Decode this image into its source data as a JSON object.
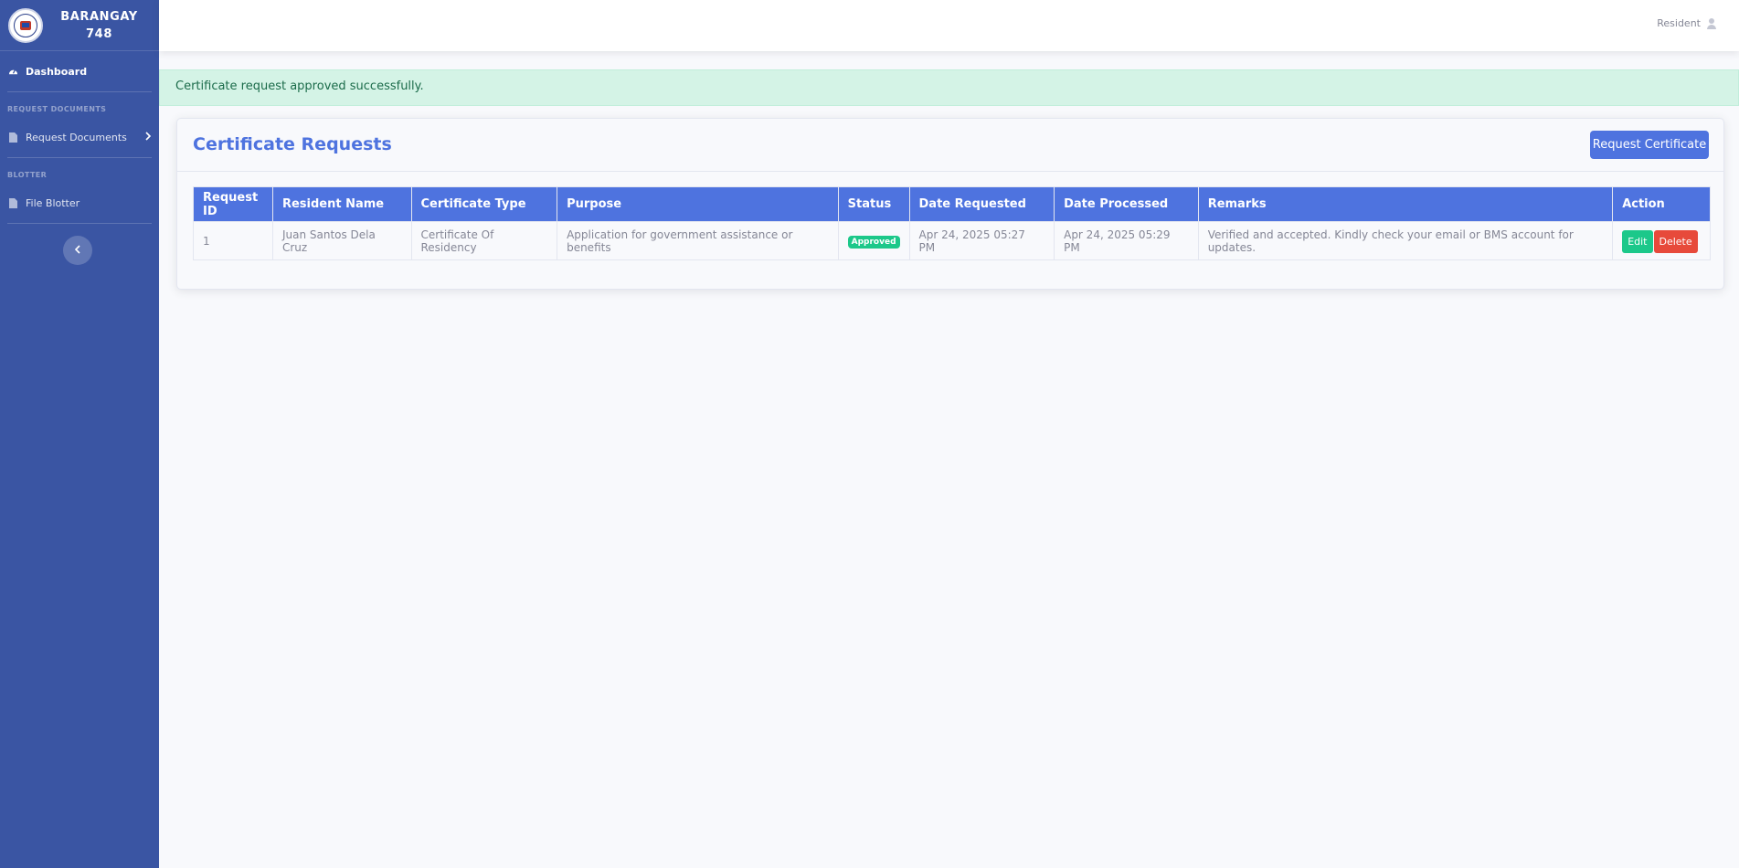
{
  "sidebar": {
    "brand_line1": "BARANGAY",
    "brand_line2": "748",
    "dashboard": "Dashboard",
    "heading_request": "REQUEST DOCUMENTS",
    "request_documents": "Request Documents",
    "heading_blotter": "BLOTTER",
    "file_blotter": "File Blotter"
  },
  "topbar": {
    "user": "Resident"
  },
  "alert": {
    "message": "Certificate request approved successfully."
  },
  "card": {
    "title": "Certificate Requests",
    "action_label": "Request Certificate"
  },
  "table": {
    "headers": [
      "Request ID",
      "Resident Name",
      "Certificate Type",
      "Purpose",
      "Status",
      "Date Requested",
      "Date Processed",
      "Remarks",
      "Action"
    ],
    "rows": [
      {
        "id": "1",
        "name": "Juan Santos Dela Cruz",
        "type": "Certificate Of Residency",
        "purpose": "Application for government assistance or benefits",
        "status": "Approved",
        "date_requested": "Apr 24, 2025 05:27 PM",
        "date_processed": "Apr 24, 2025 05:29 PM",
        "remarks": "Verified and accepted. Kindly check your email or BMS account for updates.",
        "edit_label": "Edit",
        "delete_label": "Delete"
      }
    ]
  },
  "colors": {
    "primary": "#4e73df",
    "sidebar": "#3a55a3",
    "success": "#1cc88a",
    "danger": "#e74a3b"
  },
  "icons": {
    "dashboard": "tachometer-icon",
    "request": "file-icon",
    "blotter": "file-icon",
    "chevron": "chevron-right-icon",
    "toggle": "chevron-left-icon",
    "user": "user-icon"
  }
}
